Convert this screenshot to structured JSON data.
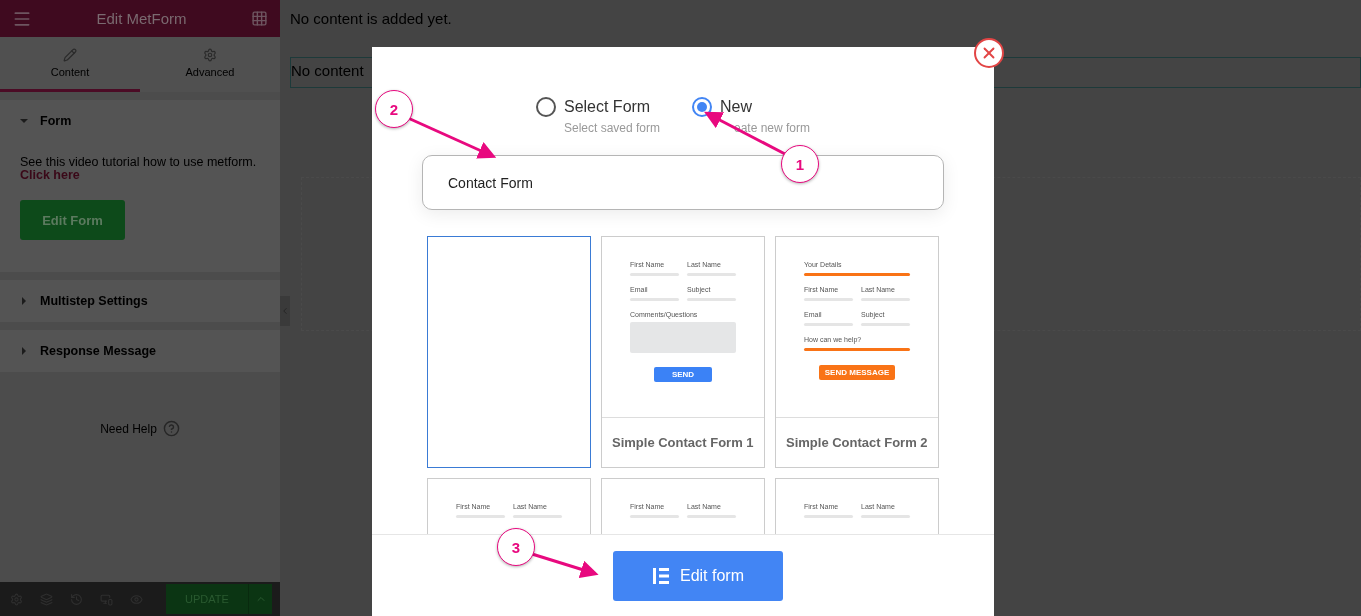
{
  "sidebar": {
    "title": "Edit MetForm",
    "tabs": [
      {
        "label": "Content",
        "selected": true
      },
      {
        "label": "Advanced",
        "selected": false
      }
    ],
    "sections": [
      {
        "title": "Form",
        "expanded": true,
        "text": "See this video tutorial how to use metform.",
        "link": "Click here",
        "button": "Edit Form"
      },
      {
        "title": "Multistep Settings",
        "expanded": false
      },
      {
        "title": "Response Message",
        "expanded": false
      }
    ],
    "help": "Need Help",
    "footer_button": "UPDATE"
  },
  "canvas": {
    "notice": "No content is added yet.",
    "box_text": "No content"
  },
  "modal": {
    "options": [
      {
        "label": "Select Form",
        "hint": "Select saved form",
        "selected": false
      },
      {
        "label": "New",
        "hint": "eate new form",
        "selected": true
      }
    ],
    "name_value": "Contact Form",
    "templates": [
      {
        "kind": "blank",
        "selected": true
      },
      {
        "kind": "preview",
        "selected": false,
        "title": "Simple Contact Form 1",
        "rows": [
          [
            "First Name",
            "Last Name"
          ],
          [
            "Email",
            "Subject"
          ]
        ],
        "message": {
          "label": "Comments/Questions",
          "kind": "textarea"
        },
        "button": "SEND",
        "color": "#3b82f6"
      },
      {
        "kind": "preview",
        "selected": false,
        "title": "Simple Contact Form 2",
        "heading": "Your Details",
        "rows": [
          [
            "First Name",
            "Last Name"
          ],
          [
            "Email",
            "Subject"
          ]
        ],
        "message": {
          "label": "How can we help?",
          "kind": "underline"
        },
        "button": "SEND MESSAGE",
        "color": "#f97316"
      },
      {
        "kind": "preview",
        "selected": false,
        "rows": [
          [
            "First Name",
            "Last Name"
          ]
        ]
      },
      {
        "kind": "preview",
        "selected": false,
        "rows": [
          [
            "First Name",
            "Last Name"
          ]
        ]
      },
      {
        "kind": "preview",
        "selected": false,
        "rows": [
          [
            "First Name",
            "Last Name"
          ]
        ]
      }
    ],
    "submit": "Edit form"
  },
  "annotations": [
    {
      "number": "1"
    },
    {
      "number": "2"
    },
    {
      "number": "3"
    }
  ]
}
